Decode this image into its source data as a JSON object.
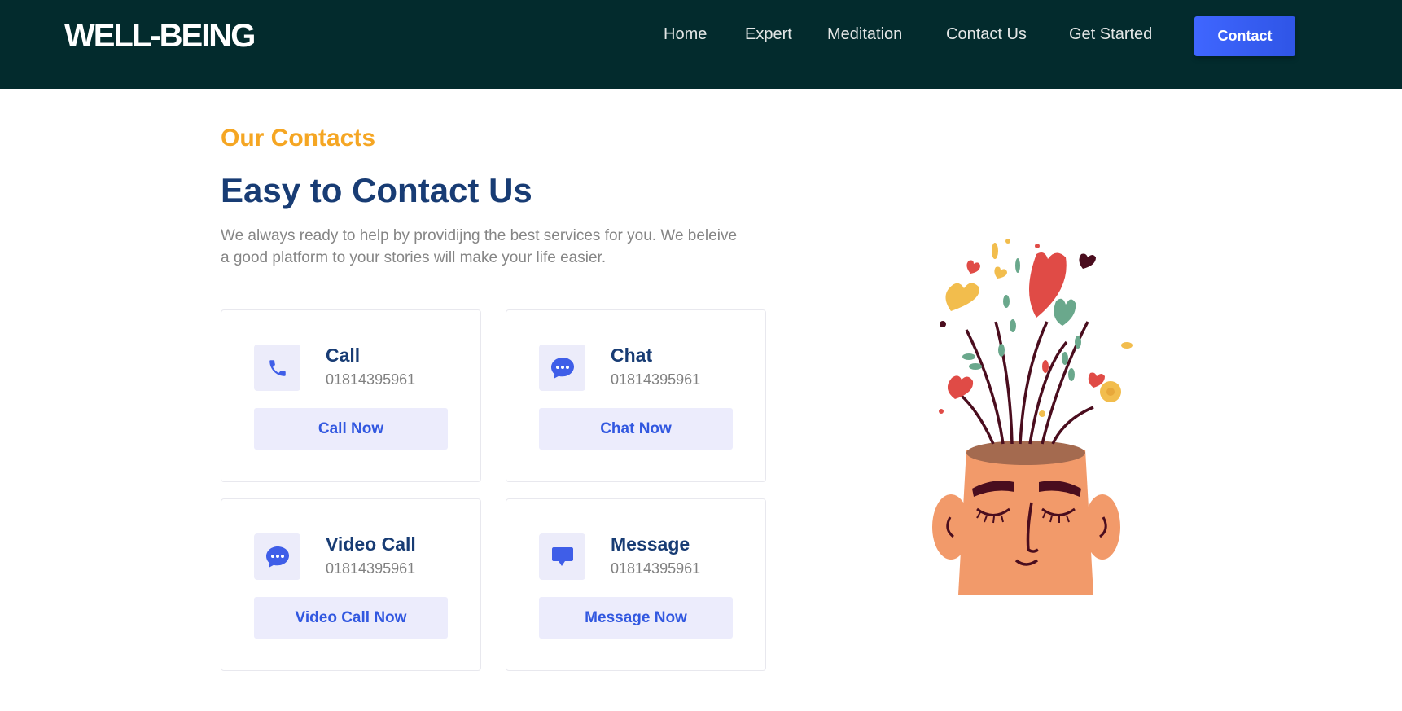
{
  "header": {
    "logo": "WELL-BEING",
    "nav": [
      "Home",
      "Expert",
      "Meditation",
      "Contact Us",
      "Get Started"
    ],
    "cta": "Contact"
  },
  "section": {
    "eyebrow": "Our Contacts",
    "title": "Easy to Contact Us",
    "description": "We always ready to help by providijng the best services for you. We beleive a good platform to your stories will make your life easier."
  },
  "cards": [
    {
      "title": "Call",
      "number": "01814395961",
      "action": "Call Now",
      "icon": "phone-icon"
    },
    {
      "title": "Chat",
      "number": "01814395961",
      "action": "Chat Now",
      "icon": "chat-bubble-icon"
    },
    {
      "title": "Video Call",
      "number": "01814395961",
      "action": "Video Call Now",
      "icon": "chat-bubble-icon"
    },
    {
      "title": "Message",
      "number": "01814395961",
      "action": "Message Now",
      "icon": "message-icon"
    }
  ],
  "colors": {
    "header_bg": "#032b2d",
    "accent": "#3f66ff",
    "eyebrow": "#f5a623",
    "heading": "#183c74"
  }
}
